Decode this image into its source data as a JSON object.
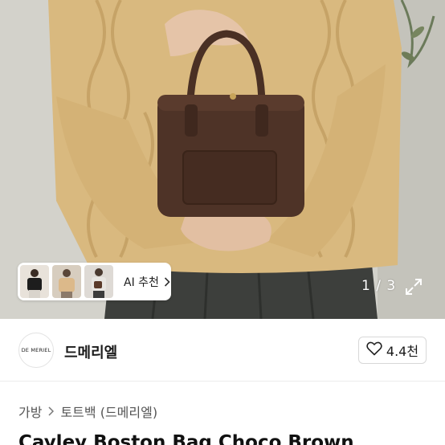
{
  "gallery": {
    "counter": "1 / 3",
    "ai_recommend_label": "AI 추천",
    "thumbnails": [
      "thumb-outfit-1",
      "thumb-outfit-2",
      "thumb-outfit-3"
    ]
  },
  "seller": {
    "logo_text": "DE MERIEL",
    "name": "드메리엘",
    "like_count": "4.4천"
  },
  "breadcrumb": {
    "items": [
      "가방",
      "토트백 (드메리엘)"
    ]
  },
  "product": {
    "title": "Cayley Boston Bag Choco Brown"
  },
  "colors": {
    "sweater": "#d9b97f",
    "bag": "#4a3024",
    "skirt": "#3d3f3c",
    "background": "#d4d3cc"
  }
}
